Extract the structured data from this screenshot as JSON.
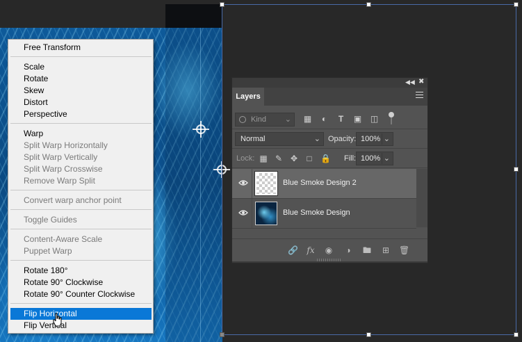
{
  "context_menu": {
    "items": [
      {
        "label": "Free Transform",
        "enabled": true
      },
      {
        "label": "Scale",
        "enabled": true
      },
      {
        "label": "Rotate",
        "enabled": true
      },
      {
        "label": "Skew",
        "enabled": true
      },
      {
        "label": "Distort",
        "enabled": true
      },
      {
        "label": "Perspective",
        "enabled": true
      },
      {
        "label": "Warp",
        "enabled": true
      },
      {
        "label": "Split Warp Horizontally",
        "enabled": false
      },
      {
        "label": "Split Warp Vertically",
        "enabled": false
      },
      {
        "label": "Split Warp Crosswise",
        "enabled": false
      },
      {
        "label": "Remove Warp Split",
        "enabled": false
      },
      {
        "label": "Convert warp anchor point",
        "enabled": false
      },
      {
        "label": "Toggle Guides",
        "enabled": false
      },
      {
        "label": "Content-Aware Scale",
        "enabled": false
      },
      {
        "label": "Puppet Warp",
        "enabled": false
      },
      {
        "label": "Rotate 180°",
        "enabled": true
      },
      {
        "label": "Rotate 90° Clockwise",
        "enabled": true
      },
      {
        "label": "Rotate 90° Counter Clockwise",
        "enabled": true
      },
      {
        "label": "Flip Horizontal",
        "enabled": true,
        "highlighted": true
      },
      {
        "label": "Flip Vertical",
        "enabled": true
      }
    ]
  },
  "layers_panel": {
    "tab_label": "Layers",
    "filter": {
      "placeholder": "Kind"
    },
    "blend_mode": "Normal",
    "opacity_label": "Opacity:",
    "opacity_value": "100%",
    "lock_label": "Lock:",
    "fill_label": "Fill:",
    "fill_value": "100%",
    "layers": [
      {
        "name": "Blue Smoke Design 2",
        "selected": true,
        "visible": true
      },
      {
        "name": "Blue Smoke Design",
        "selected": false,
        "visible": true
      }
    ],
    "footer_icons": [
      "link-layers-icon",
      "fx-icon",
      "layer-mask-icon",
      "adjustment-layer-icon",
      "new-group-icon",
      "new-layer-icon",
      "delete-layer-icon"
    ]
  },
  "colors": {
    "highlight": "#0a78d7",
    "selection_border": "#4a6aa8",
    "panel_bg": "#535353",
    "canvas_bg": "#282828"
  }
}
